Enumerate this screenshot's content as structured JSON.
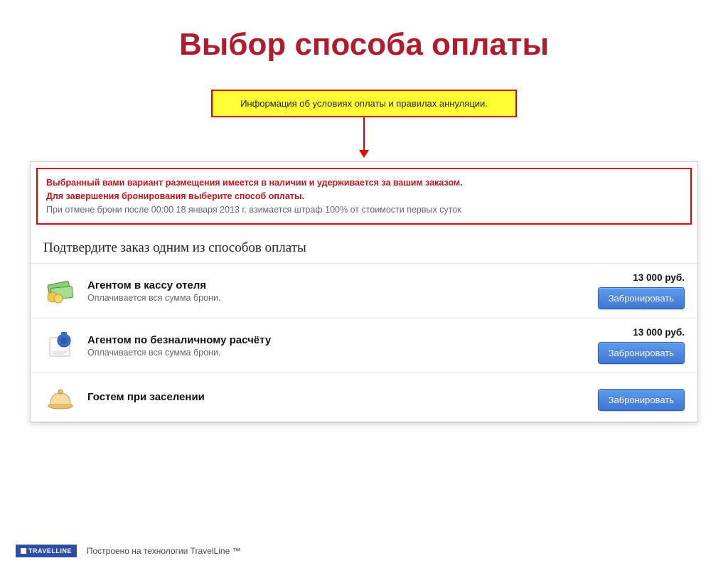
{
  "title": "Выбор способа оплаты",
  "callout": "Информация об условиях оплаты и правилах аннуляции.",
  "notice": {
    "line1": "Выбранный вами вариант размещения имеется в наличии и удерживается за вашим заказом.",
    "line2": "Для завершения бронирования выберите способ оплаты.",
    "line3": "При отмене брони после 00:00 18 января 2013 г. взимается штраф 100% от стоимости первых суток"
  },
  "confirm_heading": "Подтвердите заказ одним из способов оплаты",
  "options": [
    {
      "icon": "cash-icon",
      "title": "Агентом в кассу отеля",
      "sub": "Оплачивается вся сумма брони.",
      "price": "13 000 руб.",
      "button": "Забронировать"
    },
    {
      "icon": "invoice-icon",
      "title": "Агентом по безналичному расчёту",
      "sub": "Оплачивается вся сумма брони.",
      "price": "13 000 руб.",
      "button": "Забронировать"
    },
    {
      "icon": "bell-icon",
      "title": "Гостем при заселении",
      "sub": "",
      "price": "",
      "button": "Забронировать"
    }
  ],
  "footer": {
    "logo": "TRAVELLINE",
    "text": "Построено на технологии TravelLine ™"
  }
}
